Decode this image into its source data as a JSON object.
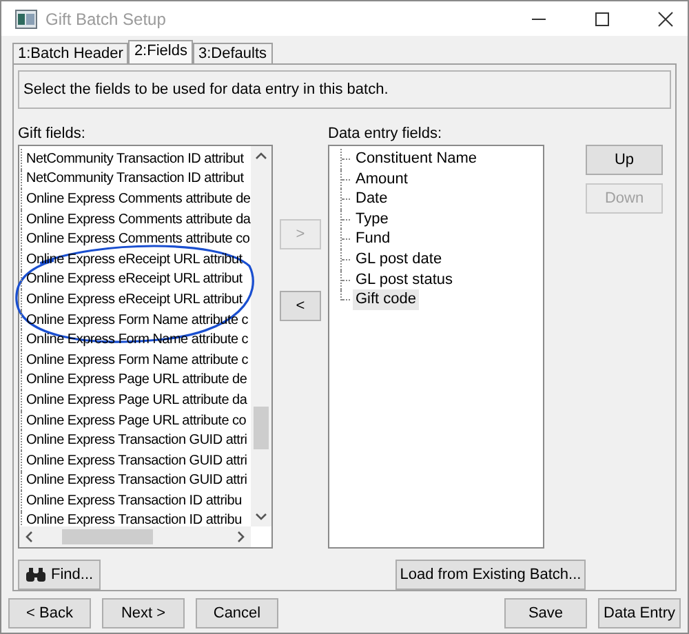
{
  "window": {
    "title": "Gift Batch Setup"
  },
  "tabs": [
    {
      "label": "1:Batch Header",
      "selected": false
    },
    {
      "label": "2:Fields",
      "selected": true
    },
    {
      "label": "3:Defaults",
      "selected": false
    }
  ],
  "instruction": "Select the fields to be used for data entry in this batch.",
  "gift_fields": {
    "label": "Gift fields:",
    "items": [
      "NetCommunity Transaction ID attribut",
      "NetCommunity Transaction ID attribut",
      "Online Express Comments attribute de",
      "Online Express Comments attribute da",
      "Online Express Comments attribute co",
      "Online Express eReceipt URL attribut",
      "Online Express eReceipt URL attribut",
      "Online Express eReceipt URL attribut",
      "Online Express Form Name attribute c",
      "Online Express Form Name attribute c",
      "Online Express Form Name attribute c",
      "Online Express Page URL attribute de",
      "Online Express Page URL attribute da",
      "Online Express Page URL attribute co",
      "Online Express Transaction GUID attri",
      "Online Express Transaction GUID attri",
      "Online Express Transaction GUID attri",
      "Online Express Transaction ID attribu",
      "Online Express Transaction ID attribu"
    ]
  },
  "move_buttons": [
    {
      "label": ">",
      "disabled": true
    },
    {
      "label": "<",
      "disabled": false
    }
  ],
  "data_entry_fields": {
    "label": "Data entry fields:",
    "items": [
      {
        "label": "Constituent Name",
        "selected": false
      },
      {
        "label": "Amount",
        "selected": false
      },
      {
        "label": "Date",
        "selected": false
      },
      {
        "label": "Type",
        "selected": false
      },
      {
        "label": "Fund",
        "selected": false
      },
      {
        "label": "GL post date",
        "selected": false
      },
      {
        "label": "GL post status",
        "selected": false
      },
      {
        "label": "Gift code",
        "selected": true
      }
    ]
  },
  "order_buttons": [
    {
      "label": "Up",
      "disabled": false
    },
    {
      "label": "Down",
      "disabled": true
    }
  ],
  "find_button": "Find...",
  "load_button": "Load from Existing Batch...",
  "annotation_circle": true,
  "wizard_buttons": [
    "< Back",
    "Next >",
    "Cancel"
  ],
  "action_buttons": [
    "Save",
    "Data Entry"
  ]
}
